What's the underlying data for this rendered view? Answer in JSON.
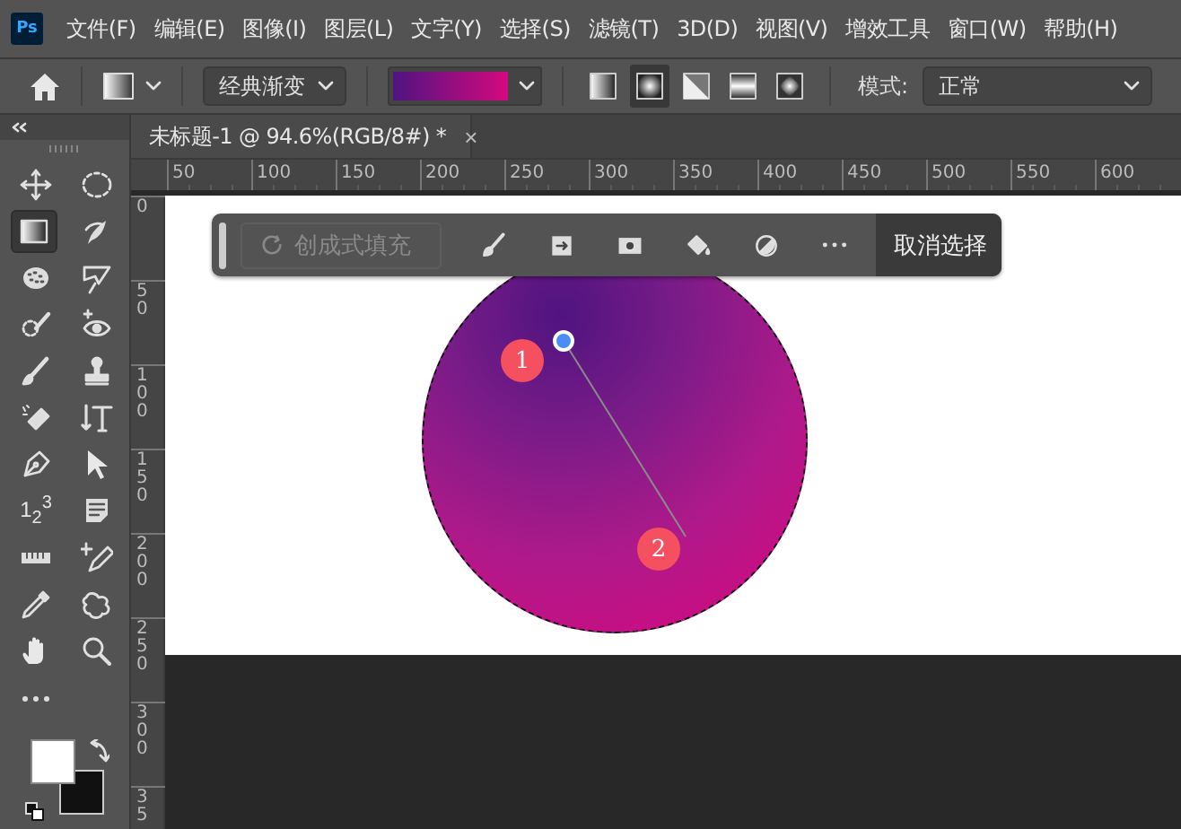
{
  "app_logo": "Ps",
  "menu": [
    "文件(F)",
    "编辑(E)",
    "图像(I)",
    "图层(L)",
    "文字(Y)",
    "选择(S)",
    "滤镜(T)",
    "3D(D)",
    "视图(V)",
    "增效工具",
    "窗口(W)",
    "帮助(H)"
  ],
  "options_bar": {
    "preset_dropdown": "经典渐变",
    "gradient_types": [
      {
        "kind": "linear",
        "selected": false
      },
      {
        "kind": "radial",
        "selected": true
      },
      {
        "kind": "angle",
        "selected": false
      },
      {
        "kind": "reflected",
        "selected": false
      },
      {
        "kind": "diamond",
        "selected": false
      }
    ],
    "mode_label": "模式:",
    "mode_value": "正常"
  },
  "tools": [
    {
      "kind": "move",
      "selected": false
    },
    {
      "kind": "ellipse",
      "selected": false
    },
    {
      "kind": "gradient",
      "selected": true
    },
    {
      "kind": "brush-select",
      "selected": false
    },
    {
      "kind": "quick",
      "selected": false
    },
    {
      "kind": "polylasso",
      "selected": false
    },
    {
      "kind": "heal",
      "selected": false
    },
    {
      "kind": "eye",
      "selected": false
    },
    {
      "kind": "brush",
      "selected": false
    },
    {
      "kind": "stamp",
      "selected": false
    },
    {
      "kind": "eraser",
      "selected": false
    },
    {
      "kind": "vtype",
      "selected": false
    },
    {
      "kind": "pen",
      "selected": false
    },
    {
      "kind": "arrow",
      "selected": false
    },
    {
      "kind": "count",
      "selected": false,
      "glyph": "1$_{2}$$^{3}$"
    },
    {
      "kind": "note",
      "selected": false
    },
    {
      "kind": "ruler",
      "selected": false
    },
    {
      "kind": "sampler",
      "selected": false
    },
    {
      "kind": "dropper",
      "selected": false
    },
    {
      "kind": "puppet",
      "selected": false
    },
    {
      "kind": "hand",
      "selected": false
    },
    {
      "kind": "zoom",
      "selected": false
    },
    {
      "kind": "more",
      "selected": false
    }
  ],
  "document_tab": {
    "title": "未标题-1 @ 94.6%(RGB/8#) *",
    "close": "×"
  },
  "ruler_h": [
    "50",
    "100",
    "150",
    "200",
    "250",
    "300",
    "350",
    "400",
    "450",
    "500",
    "550",
    "600"
  ],
  "ruler_v": [
    "0",
    "50",
    "100",
    "150",
    "200",
    "250",
    "300",
    "35"
  ],
  "taskbar": {
    "generate_button": {
      "label": "创成式填充",
      "disabled": true
    },
    "tools": [
      {
        "kind": "brush"
      },
      {
        "kind": "subject"
      },
      {
        "kind": "mask"
      },
      {
        "kind": "bucket"
      },
      {
        "kind": "adjust"
      },
      {
        "kind": "more"
      }
    ],
    "deselect_button": "取消选择"
  },
  "canvas": {
    "markers": [
      "1",
      "2"
    ]
  }
}
